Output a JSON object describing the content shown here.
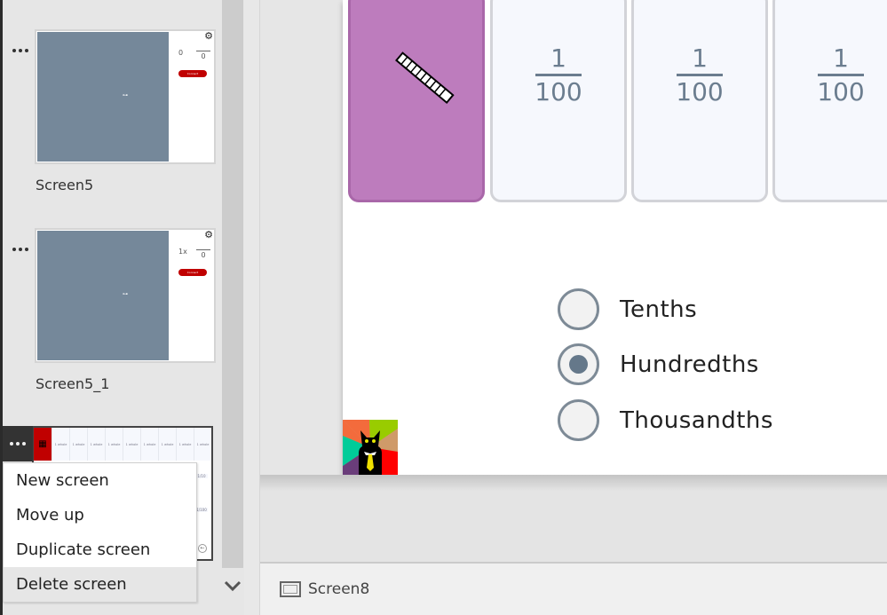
{
  "screens_pane": {
    "screens": [
      {
        "name": "Screen5",
        "thumbnail": {
          "left_number": "0",
          "fraction_denominator": "0",
          "button_label": "Connect",
          "center_glyph": "⊶",
          "settings_icon": "gear-icon"
        }
      },
      {
        "name": "Screen5_1",
        "thumbnail": {
          "left_number": "1x",
          "fraction_denominator": "0",
          "button_label": "Connect",
          "center_glyph": "⊶",
          "settings_icon": "gear-icon"
        }
      },
      {
        "name": "Screen8",
        "selected": true,
        "thumbnail": {
          "row_labels": [
            "1 whole",
            "1 whole",
            "1 whole",
            "1 whole",
            "1 whole",
            "1 whole",
            "1 whole",
            "1 whole",
            "1 whole"
          ],
          "fraction_tenth": "1/10",
          "fraction_hundredth": "1/100"
        }
      }
    ],
    "more_options_icon": "ellipsis-icon",
    "scroll_down_icon": "chevron-down-icon"
  },
  "context_menu": {
    "items": [
      {
        "label": "New screen"
      },
      {
        "label": "Move up"
      },
      {
        "label": "Duplicate screen"
      },
      {
        "label": "Delete screen",
        "hovered": true
      }
    ]
  },
  "canvas": {
    "tiles": [
      {
        "type": "image",
        "icon": "hundredths-rod-icon",
        "color": "#bd7cbd"
      },
      {
        "numerator": "1",
        "denominator": "100"
      },
      {
        "numerator": "1",
        "denominator": "100"
      },
      {
        "numerator": "1",
        "denominator": "100"
      }
    ],
    "radio_options": [
      {
        "label": "Tenths",
        "checked": false
      },
      {
        "label": "Hundredths",
        "checked": true
      },
      {
        "label": "Thousandths",
        "checked": false
      }
    ],
    "logo": "business-cat-logo"
  },
  "status_bar": {
    "screen_name": "Screen8",
    "icon": "screen-icon"
  }
}
